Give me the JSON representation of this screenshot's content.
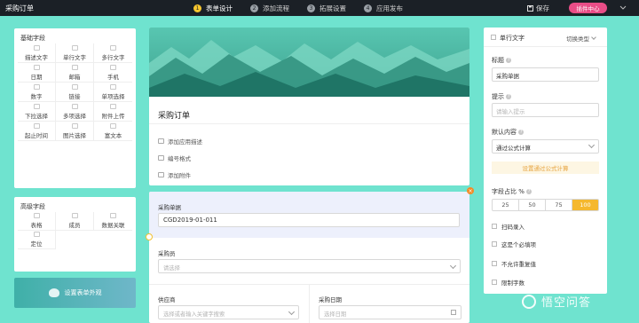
{
  "app": {
    "title": "采购订单"
  },
  "steps": [
    {
      "num": "1",
      "label": "表单设计",
      "active": true
    },
    {
      "num": "2",
      "label": "添加流程",
      "active": false
    },
    {
      "num": "3",
      "label": "拓展设置",
      "active": false
    },
    {
      "num": "4",
      "label": "应用发布",
      "active": false
    }
  ],
  "toolbar": {
    "save_label": "保存",
    "plugin_label": "插件中心",
    "menu_icon": "chevron-down-icon"
  },
  "basic_fields": {
    "title": "基础字段",
    "items": [
      "描述文字",
      "单行文字",
      "多行文字",
      "日期",
      "邮箱",
      "手机",
      "数字",
      "链接",
      "单项选择",
      "下拉选择",
      "多项选择",
      "附件上传",
      "起止时间",
      "图片选择",
      "富文本"
    ]
  },
  "advanced_fields": {
    "title": "高级字段",
    "items": [
      "表格",
      "成员",
      "数据关联",
      "定位"
    ]
  },
  "appearance_button": "设置表单外观",
  "form": {
    "title": "采购订单",
    "links": [
      "添加应用描述",
      "编号格式",
      "添加附件"
    ]
  },
  "fields": {
    "purchase_no": {
      "label": "采购单据",
      "value": "CGD2019-01-011"
    },
    "buyer": {
      "label": "采购员",
      "placeholder": "请选择"
    },
    "supplier": {
      "label": "供应商",
      "placeholder": "选择或者输入关键字搜索"
    },
    "purchase_date": {
      "label": "采购日期",
      "placeholder": "选择日期"
    }
  },
  "props": {
    "field_type": "单行文字",
    "switch_type": "切换类型",
    "title_label": "标题",
    "title_value": "采购单据",
    "hint_label": "提示",
    "hint_placeholder": "请输入提示",
    "default_label": "默认内容",
    "default_value": "通过公式计算",
    "formula_button": "设置通过公式计算",
    "ratio_label": "字段占比 %",
    "ratios": [
      "25",
      "50",
      "75",
      "100"
    ],
    "ratio_selected": "100",
    "options": [
      "扫码录入",
      "这是个必填项",
      "不允许重复值",
      "限制字数"
    ]
  },
  "watermark": "悟空问答",
  "colors": {
    "background": "#6fe3cf",
    "topbar": "#1b2026",
    "accent_yellow": "#f5b82e",
    "plugin_pink": "#e94d87"
  }
}
